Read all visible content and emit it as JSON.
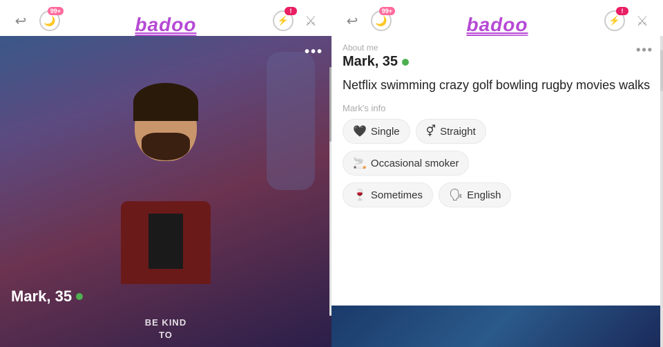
{
  "left_panel": {
    "top_bar": {
      "logo": "badoo",
      "badge": "99+",
      "undo_label": "↩",
      "icons": [
        "undo",
        "moon",
        "badge-99",
        "lightning",
        "crossed-swords"
      ]
    },
    "profile": {
      "name": "Mark, 35",
      "online": true,
      "more_dots": "•••",
      "bottom_text_line1": "BE KIND",
      "bottom_text_line2": "TO"
    }
  },
  "right_panel": {
    "top_bar": {
      "logo": "badoo",
      "badge": "99+",
      "icons": [
        "undo",
        "moon",
        "badge-99",
        "lightning",
        "crossed-swords"
      ]
    },
    "profile": {
      "name": "Mark, 35",
      "online": true,
      "about_label": "About me",
      "about_text": "Netflix swimming crazy golf bowling rugby movies walks",
      "more_dots": "•••",
      "marks_info_label": "Mark's info",
      "tags": [
        {
          "icon": "♥",
          "label": "Single"
        },
        {
          "icon": "⚥",
          "label": "Straight"
        },
        {
          "icon": "🚬",
          "label": "Occasional smoker"
        },
        {
          "icon": "🍷",
          "label": "Sometimes"
        },
        {
          "icon": "🗣",
          "label": "English"
        }
      ]
    }
  }
}
